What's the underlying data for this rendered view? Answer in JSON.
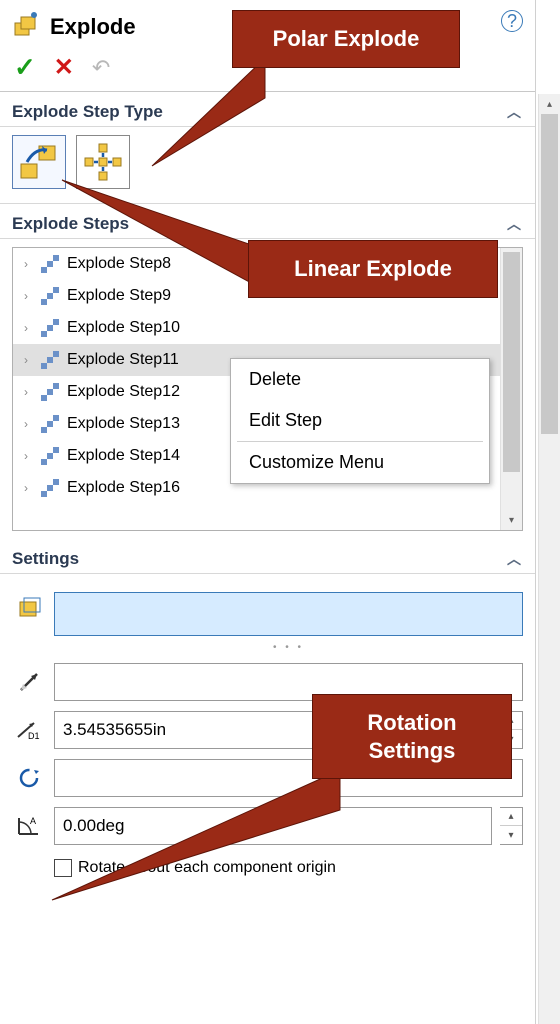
{
  "header": {
    "title": "Explode",
    "help_tooltip": "?"
  },
  "sections": {
    "type": {
      "title": "Explode Step Type"
    },
    "steps": {
      "title": "Explode Steps"
    },
    "settings": {
      "title": "Settings"
    }
  },
  "steps": [
    {
      "label": "Explode Step8"
    },
    {
      "label": "Explode Step9"
    },
    {
      "label": "Explode Step10"
    },
    {
      "label": "Explode Step11",
      "selected": true
    },
    {
      "label": "Explode Step12"
    },
    {
      "label": "Explode Step13"
    },
    {
      "label": "Explode Step14"
    },
    {
      "label": "Explode Step16"
    }
  ],
  "context_menu": {
    "delete": "Delete",
    "edit": "Edit Step",
    "customize": "Customize Menu"
  },
  "settings": {
    "distance_value": "3.54535655in",
    "angle_value": "0.00deg",
    "rotate_origin_label": "Rotate about each component origin"
  },
  "callouts": {
    "polar": "Polar Explode",
    "linear": "Linear Explode",
    "rotation_l1": "Rotation",
    "rotation_l2": "Settings"
  },
  "colors": {
    "callout_bg": "#9a2a16",
    "accent": "#3a7ab8"
  }
}
